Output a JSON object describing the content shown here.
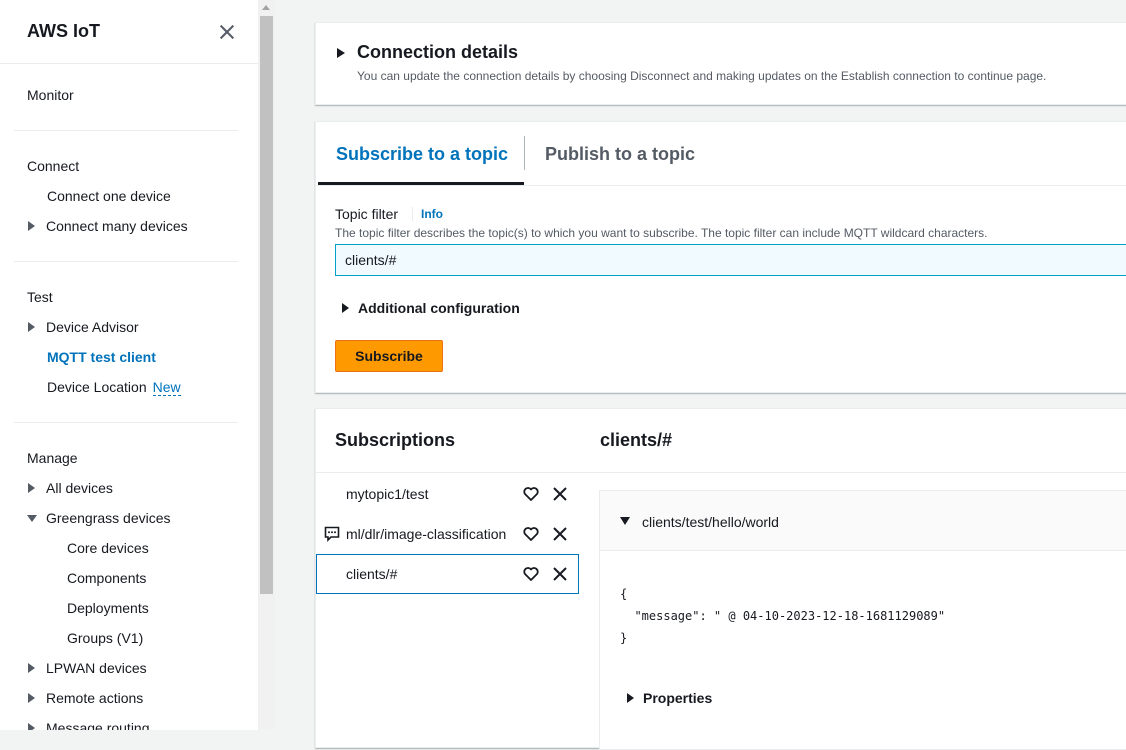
{
  "sidebar": {
    "title": "AWS IoT",
    "monitor": "Monitor",
    "connect": {
      "heading": "Connect",
      "items": [
        "Connect one device",
        "Connect many devices"
      ]
    },
    "test": {
      "heading": "Test",
      "items": [
        "Device Advisor",
        "MQTT test client",
        "Device Location"
      ],
      "new_badge": "New"
    },
    "manage": {
      "heading": "Manage",
      "items": [
        "All devices",
        "Greengrass devices",
        "Core devices",
        "Components",
        "Deployments",
        "Groups (V1)",
        "LPWAN devices",
        "Remote actions",
        "Message routing"
      ]
    }
  },
  "connection": {
    "title": "Connection details",
    "description": "You can update the connection details by choosing Disconnect and making updates on the Establish connection to continue page."
  },
  "tabs": [
    "Subscribe to a topic",
    "Publish to a topic"
  ],
  "subscribe_form": {
    "topic_filter_label": "Topic filter",
    "info_link": "Info",
    "description": "The topic filter describes the topic(s) to which you want to subscribe. The topic filter can include MQTT wildcard characters.",
    "topic_value": "clients/#",
    "additional_config": "Additional configuration",
    "subscribe_button": "Subscribe"
  },
  "subscriptions": {
    "heading": "Subscriptions",
    "items": [
      "mytopic1/test",
      "ml/dlr/image-classification",
      "clients/#"
    ],
    "selected_topic": "clients/#"
  },
  "message": {
    "topic": "clients/test/hello/world",
    "payload_open": "{",
    "payload_line": "  \"message\": \" @ 04-10-2023-12-18-1681129089\"",
    "payload_close": "}",
    "properties_label": "Properties"
  }
}
